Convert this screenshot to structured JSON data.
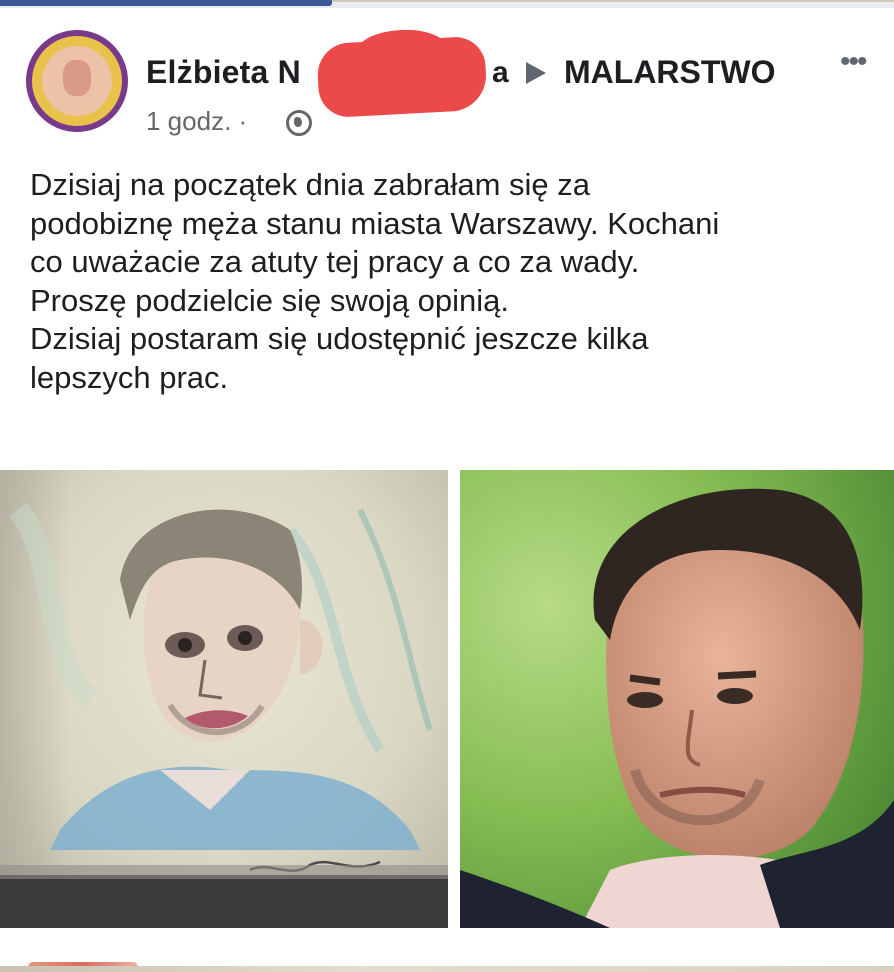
{
  "post": {
    "author_visible": "Elżbieta N",
    "author_tail": "a",
    "group": "MALARSTWO",
    "more": "•••",
    "time": "1 godz. ·",
    "text_lines": [
      "Dzisiaj na początek dnia zabrałam się za",
      "podobiznę męża stanu miasta Warszawy. Kochani",
      "co uważacie za atuty tej pracy a co za wady.",
      "Proszę podzielcie się swoją opinią.",
      "Dzisiaj postaram się udostępnić jeszcze kilka",
      "lepszych prac."
    ]
  },
  "icons": {
    "arrow": "right-triangle-icon",
    "more": "more-options-icon",
    "privacy": "globe-icon"
  },
  "colors": {
    "accent": "#3b5998",
    "redaction": "#ec4a4a",
    "meta_text": "#65676b"
  }
}
